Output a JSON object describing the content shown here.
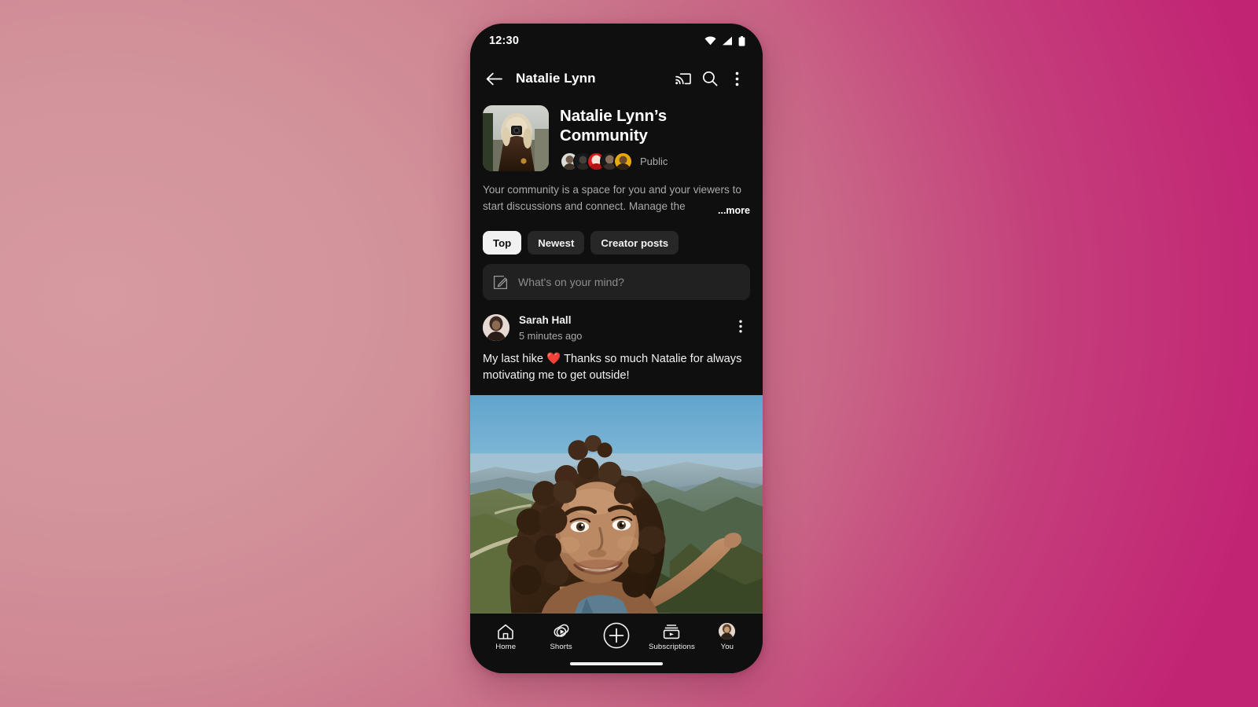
{
  "status_bar": {
    "time": "12:30",
    "icons": [
      "wifi-icon",
      "cell-signal-icon",
      "battery-icon"
    ]
  },
  "app_bar": {
    "back_label": "back-arrow-icon",
    "title": "Natalie Lynn",
    "cast_label": "cast-icon",
    "search_label": "search-icon",
    "overflow_label": "more-vertical-icon"
  },
  "community": {
    "title": "Natalie Lynn’s Community",
    "privacy": "Public",
    "member_count_shown": 5,
    "description": "Your community is a space for you and your viewers to start discussions and connect. Manage the",
    "more_label": "...more"
  },
  "filters": {
    "chips": [
      {
        "label": "Top",
        "active": true
      },
      {
        "label": "Newest",
        "active": false
      },
      {
        "label": "Creator posts",
        "active": false
      }
    ]
  },
  "composer": {
    "placeholder": "What's on your mind?",
    "icon": "compose-pencil-icon"
  },
  "post": {
    "author": "Sarah Hall",
    "timestamp": "5 minutes ago",
    "body_before_emoji": "My last hike ",
    "emoji": "❤️",
    "body_after_emoji": " Thanks so much Natalie for always motivating me to get outside!",
    "menu_label": "more-vertical-icon",
    "image_alt": "Smiling person on a mountain trail with a valley view"
  },
  "bottom_nav": [
    {
      "label": "Home",
      "icon": "home-icon",
      "active": true
    },
    {
      "label": "Shorts",
      "icon": "shorts-icon",
      "active": false
    },
    {
      "label": "",
      "icon": "create-plus-icon",
      "active": false
    },
    {
      "label": "Subscriptions",
      "icon": "subscriptions-icon",
      "active": false
    },
    {
      "label": "You",
      "icon": "account-avatar-icon",
      "active": false
    }
  ],
  "colors": {
    "background_left": "#d3949b",
    "background_right": "#c42274",
    "screen_background": "#0f0f0f",
    "chip_inactive": "#272727",
    "chip_active": "#f1f1f1",
    "composer_background": "#212121",
    "text_primary": "#f1f1f1",
    "text_secondary": "#aaaaaa",
    "heart_red": "#e8303a"
  }
}
